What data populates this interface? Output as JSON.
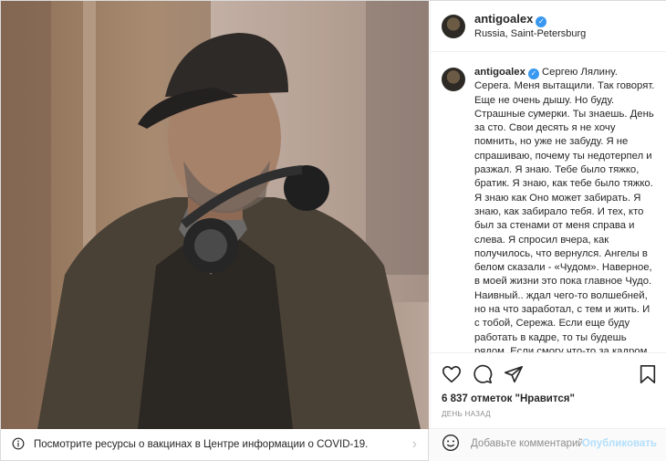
{
  "header": {
    "username": "antigoalex",
    "location": "Russia, Saint-Petersburg"
  },
  "caption": {
    "username": "antigoalex",
    "text": "Сергею Лялину. Серега. Меня вытащили. Так говорят. Еще не очень дышу. Но буду. Страшные сумерки. Ты знаешь. День за сто. Свои десять я не хочу помнить, но уже не забуду. Я не спрашиваю, почему ты недотерпел и разжал. Я знаю. Тебе было тяжко, братик. Я знаю, как тебе было тяжко. Я знаю как Оно может забирать. Я знаю, как забирало тебя. И тех, кто был за стенами от меня справа и слева. Я спросил вчера, как получилось, что вернулся. Ангелы в белом сказали - «Чудом». Наверное, в моей жизни это пока главное Чудо. Наивный.. ждал чего-то волшебней, но на что заработал, с тем и жить. И с тобой, Сережа. Если еще буду работать в кадре, то ты будешь рядом. Если смогу что-то за кадром, то с мыслями о тебе. На"
  },
  "actions": {
    "likes": "6 837 отметок \"Нравится\"",
    "time_ago": "ДЕНЬ НАЗАД",
    "icons": [
      "heart-icon",
      "comment-icon",
      "share-icon",
      "bookmark-icon"
    ]
  },
  "comment": {
    "placeholder": "Добавьте комментарий...",
    "publish_label": "Опубликовать"
  },
  "covid_banner": {
    "text": "Посмотрите ресурсы о вакцинах в Центре информации о COVID-19.",
    "chevron": "›"
  },
  "colors": {
    "verified": "#3897f0",
    "publish_disabled": "#b2dffc",
    "border": "#dbdbdb",
    "muted": "#8e8e8e"
  }
}
